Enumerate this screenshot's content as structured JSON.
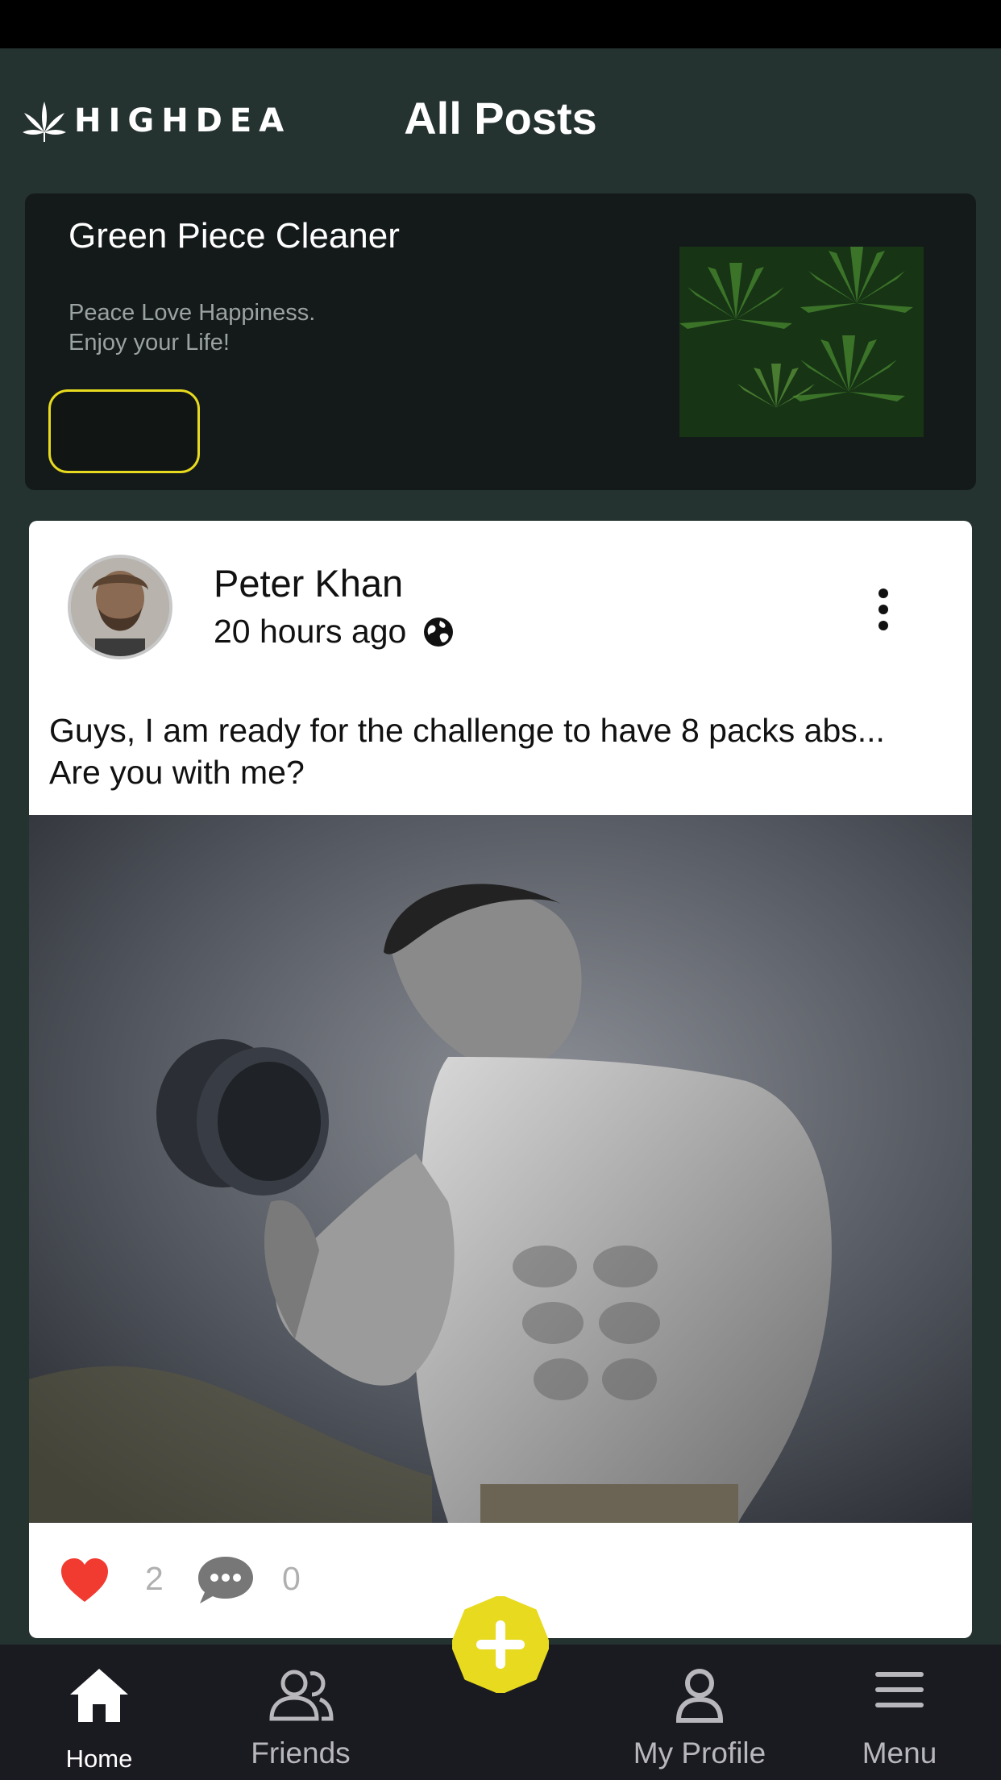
{
  "header": {
    "logo_text": "HIGHDEA",
    "title": "All Posts"
  },
  "ad": {
    "title": "Green Piece Cleaner",
    "subtitle_lines": [
      "Peace Love Happiness.",
      "Enjoy your Life!"
    ],
    "button_label": ""
  },
  "post": {
    "author": "Peter Khan",
    "time": "20 hours ago",
    "text_lines": [
      "Guys, I am ready for the challenge to have 8 packs abs...",
      "Are you with me?"
    ],
    "likes": "2",
    "comments": "0"
  },
  "nav": {
    "items": [
      {
        "label": "Home",
        "icon": "home-icon",
        "active": true
      },
      {
        "label": "Friends",
        "icon": "friends-icon",
        "active": false
      },
      {
        "label": "My Profile",
        "icon": "profile-icon",
        "active": false
      },
      {
        "label": "Menu",
        "icon": "menu-icon",
        "active": false
      }
    ]
  },
  "colors": {
    "background": "#243230",
    "accent_yellow": "#e7da1f",
    "like_red": "#f23b30",
    "nav_bg": "#1a1a21"
  }
}
